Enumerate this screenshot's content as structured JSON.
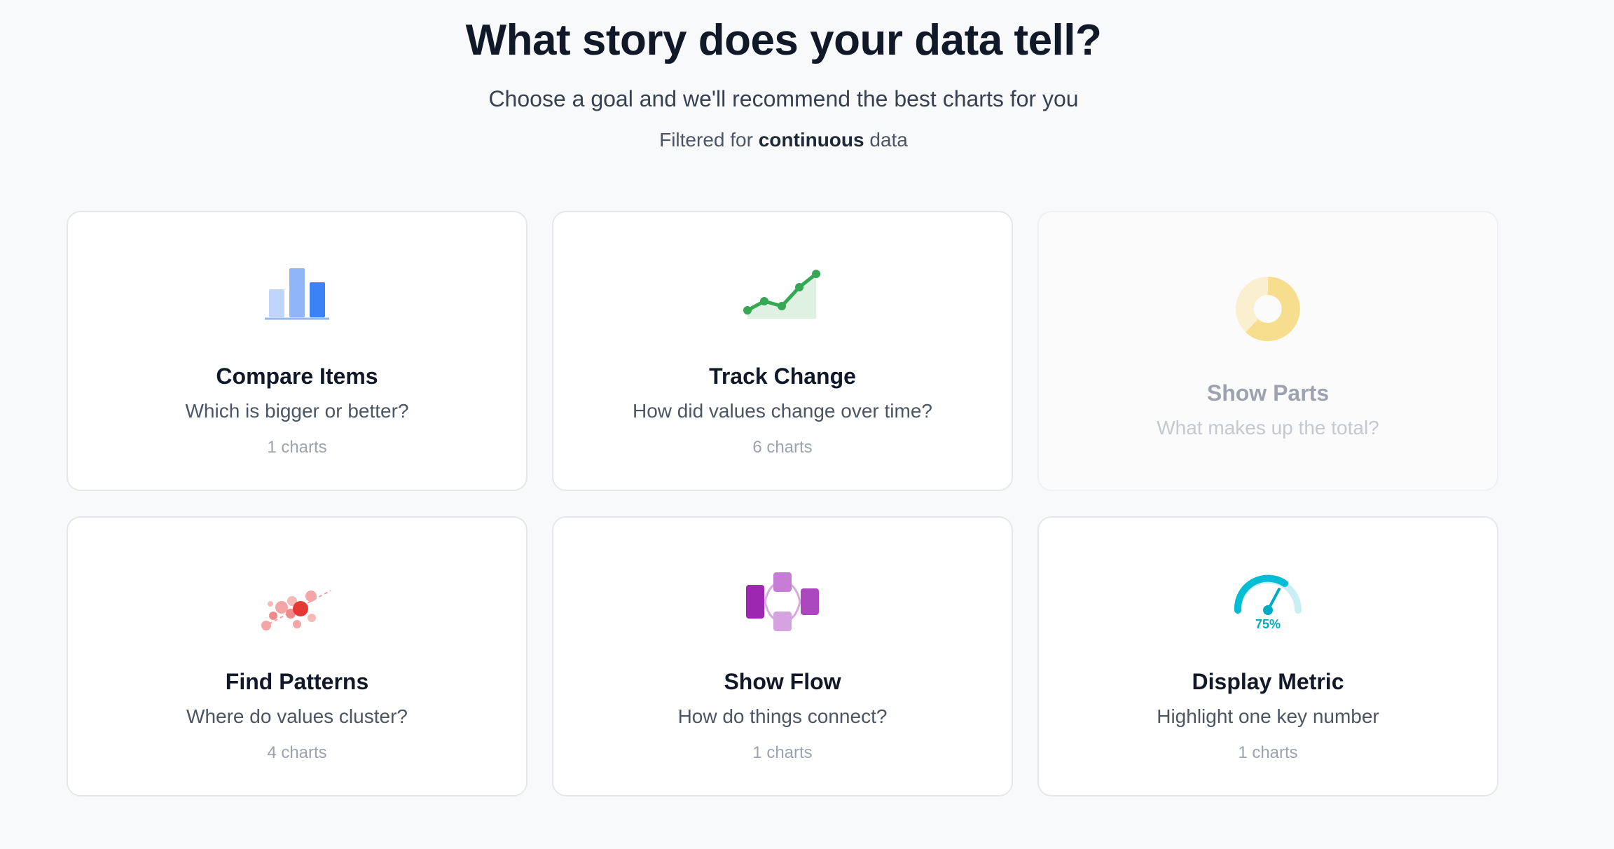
{
  "header": {
    "title": "What story does your data tell?",
    "subtitle": "Choose a goal and we'll recommend the best charts for you",
    "filter_prefix": "Filtered for",
    "filter_type": "continuous",
    "filter_suffix": "data"
  },
  "cards": [
    {
      "title": "Compare Items",
      "description": "Which is bigger or better?",
      "count": "1 charts",
      "icon": "bar-chart-icon",
      "accent": "#3b82f6"
    },
    {
      "title": "Track Change",
      "description": "How did values change over time?",
      "count": "6 charts",
      "icon": "line-chart-icon",
      "accent": "#34a853"
    },
    {
      "title": "Show Parts",
      "description": "What makes up the total?",
      "count": "",
      "icon": "donut-chart-icon",
      "accent": "#f7de8f",
      "disabled": true
    },
    {
      "title": "Find Patterns",
      "description": "Where do values cluster?",
      "count": "4 charts",
      "icon": "scatter-plot-icon",
      "accent": "#e53935"
    },
    {
      "title": "Show Flow",
      "description": "How do things connect?",
      "count": "1 charts",
      "icon": "flow-diagram-icon",
      "accent": "#9c27b0"
    },
    {
      "title": "Display Metric",
      "description": "Highlight one key number",
      "count": "1 charts",
      "icon": "gauge-icon",
      "gauge_label": "75%",
      "accent": "#00bcd4"
    }
  ]
}
